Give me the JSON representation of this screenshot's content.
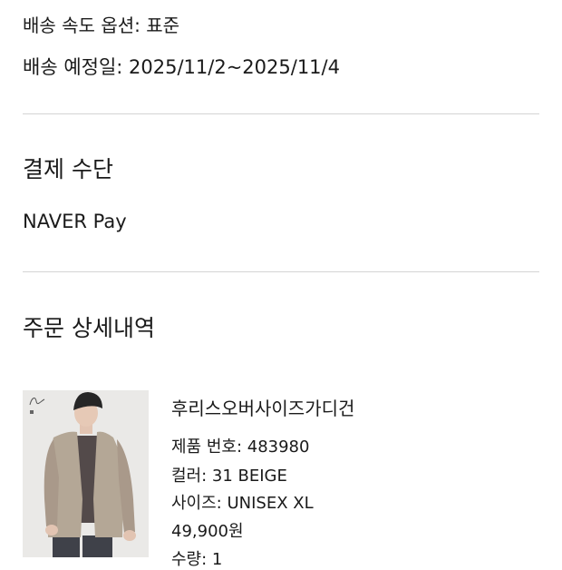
{
  "shipping": {
    "speed_option": "배송 속도 옵션: 표준",
    "expected_date": "배송 예정일: 2025/11/2~2025/11/4"
  },
  "payment": {
    "title": "결제 수단",
    "method": "NAVER Pay"
  },
  "order_details": {
    "title": "주문 상세내역",
    "item": {
      "name": "후리스오버사이즈가디건",
      "product_code": "제품 번호: 483980",
      "color": "컬러: 31 BEIGE",
      "size": "사이즈: UNISEX XL",
      "price": "49,900원",
      "quantity": "수량: 1"
    }
  },
  "colors": {
    "text": "#1a1a1a",
    "divider": "#d4d4d4",
    "cardigan": "#b4a796",
    "image_background": "#e9e8e6"
  }
}
